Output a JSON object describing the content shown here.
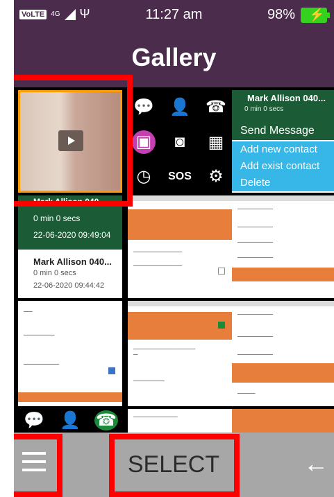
{
  "status_bar": {
    "volte": "VoLTE",
    "network": "4G",
    "time": "11:27 am",
    "battery": "98%"
  },
  "header": {
    "title": "Gallery"
  },
  "gallery": {
    "contact_menu": {
      "name": "Mark Allison 040...",
      "duration": "0 min 0 secs",
      "options": [
        "Send Message",
        "Add new contact",
        "Add exist contact",
        "Delete"
      ]
    },
    "call_log": {
      "name_top": "Mark Allison 040...",
      "duration1": "0 min 0 secs",
      "date1": "22-06-2020 09:49:04",
      "name2": "Mark Allison 040...",
      "duration2": "0 min 0 secs",
      "date2": "22-06-2020 09:44:42",
      "name3": "Mark Allison 040..."
    }
  },
  "bottom_bar": {
    "select_label": "SELECT",
    "back_glyph": "←"
  },
  "colors": {
    "header_bg": "#4b2c4c",
    "bottom_bg": "#a7a7a7",
    "accent_green": "#1b5c36",
    "accent_blue": "#36b7e8",
    "accent_orange": "#e87e3c",
    "highlight_red": "#ff0000"
  }
}
